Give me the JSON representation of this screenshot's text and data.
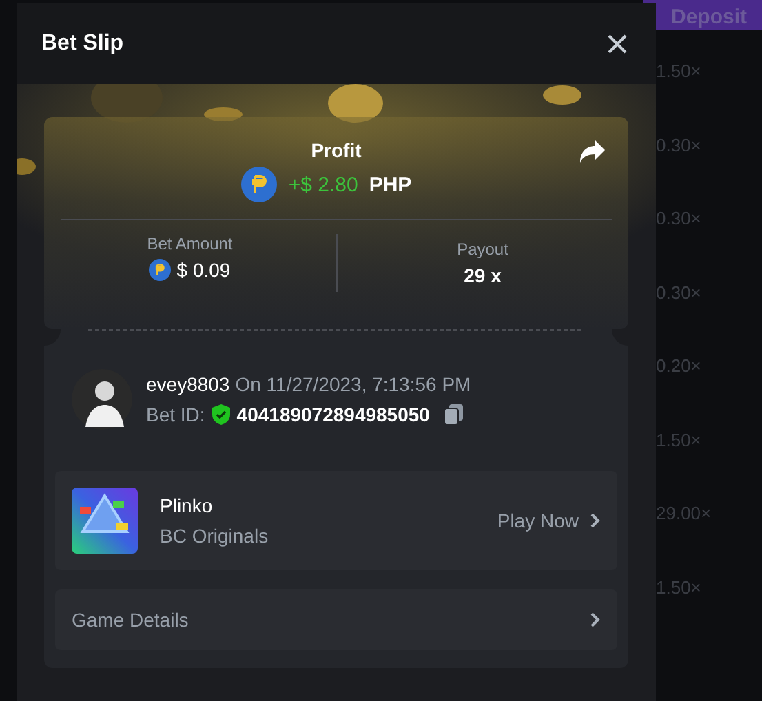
{
  "background": {
    "deposit_button": "Deposit",
    "multipliers": [
      "1.50×",
      "0.30×",
      "0.30×",
      "0.30×",
      "0.20×",
      "1.50×",
      "29.00×",
      "1.50×"
    ]
  },
  "modal": {
    "title": "Bet Slip",
    "profit": {
      "label": "Profit",
      "amount": "+$ 2.80",
      "currency": "PHP"
    },
    "bet_amount": {
      "label": "Bet Amount",
      "value": "$ 0.09"
    },
    "payout": {
      "label": "Payout",
      "value": "29 x"
    },
    "user": {
      "name": "evey8803",
      "date": "On 11/27/2023, 7:13:56 PM",
      "bet_id_label": "Bet ID:",
      "bet_id": "404189072894985050",
      "verified": true
    },
    "game": {
      "name": "Plinko",
      "provider": "BC Originals",
      "action": "Play Now"
    },
    "details": {
      "label": "Game Details"
    }
  }
}
